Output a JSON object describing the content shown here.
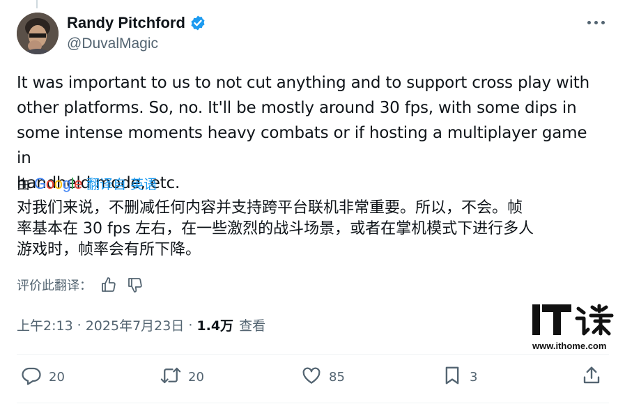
{
  "author": {
    "name": "Randy Pitchford",
    "handle": "@DuvalMagic"
  },
  "tweet": {
    "text": "It was important to us to not cut anything and to support cross play with\nother platforms.  So, no. It'll be mostly around 30 fps, with some dips in\nsome intense moments heavy combats or if hosting a multiplayer game in\nhandheld mode, etc."
  },
  "translation": {
    "by_label": "由",
    "provider": "Google",
    "translated_from": "翻译自 英语",
    "text": "对我们来说，不删减任何内容并支持跨平台联机非常重要。所以，不会。帧\n率基本在 30 fps 左右，在一些激烈的战斗场景，或者在掌机模式下进行多人\n游戏时，帧率会有所下降。",
    "rate_label": "评价此翻译："
  },
  "meta": {
    "time": "上午2:13",
    "date": "2025年7月23日",
    "views": "1.4万",
    "views_label": "查看"
  },
  "actions": {
    "replies": "20",
    "reposts": "20",
    "likes": "85",
    "bookmarks": "3"
  },
  "watermark": {
    "url": "www.ithome.com"
  },
  "colors": {
    "accent": "#1d9bf0",
    "secondary_text": "#536471"
  },
  "icons": [
    "verified-badge-icon",
    "more-icon",
    "thumbs-up-icon",
    "thumbs-down-icon",
    "reply-icon",
    "repost-icon",
    "like-icon",
    "bookmark-icon",
    "share-icon"
  ]
}
